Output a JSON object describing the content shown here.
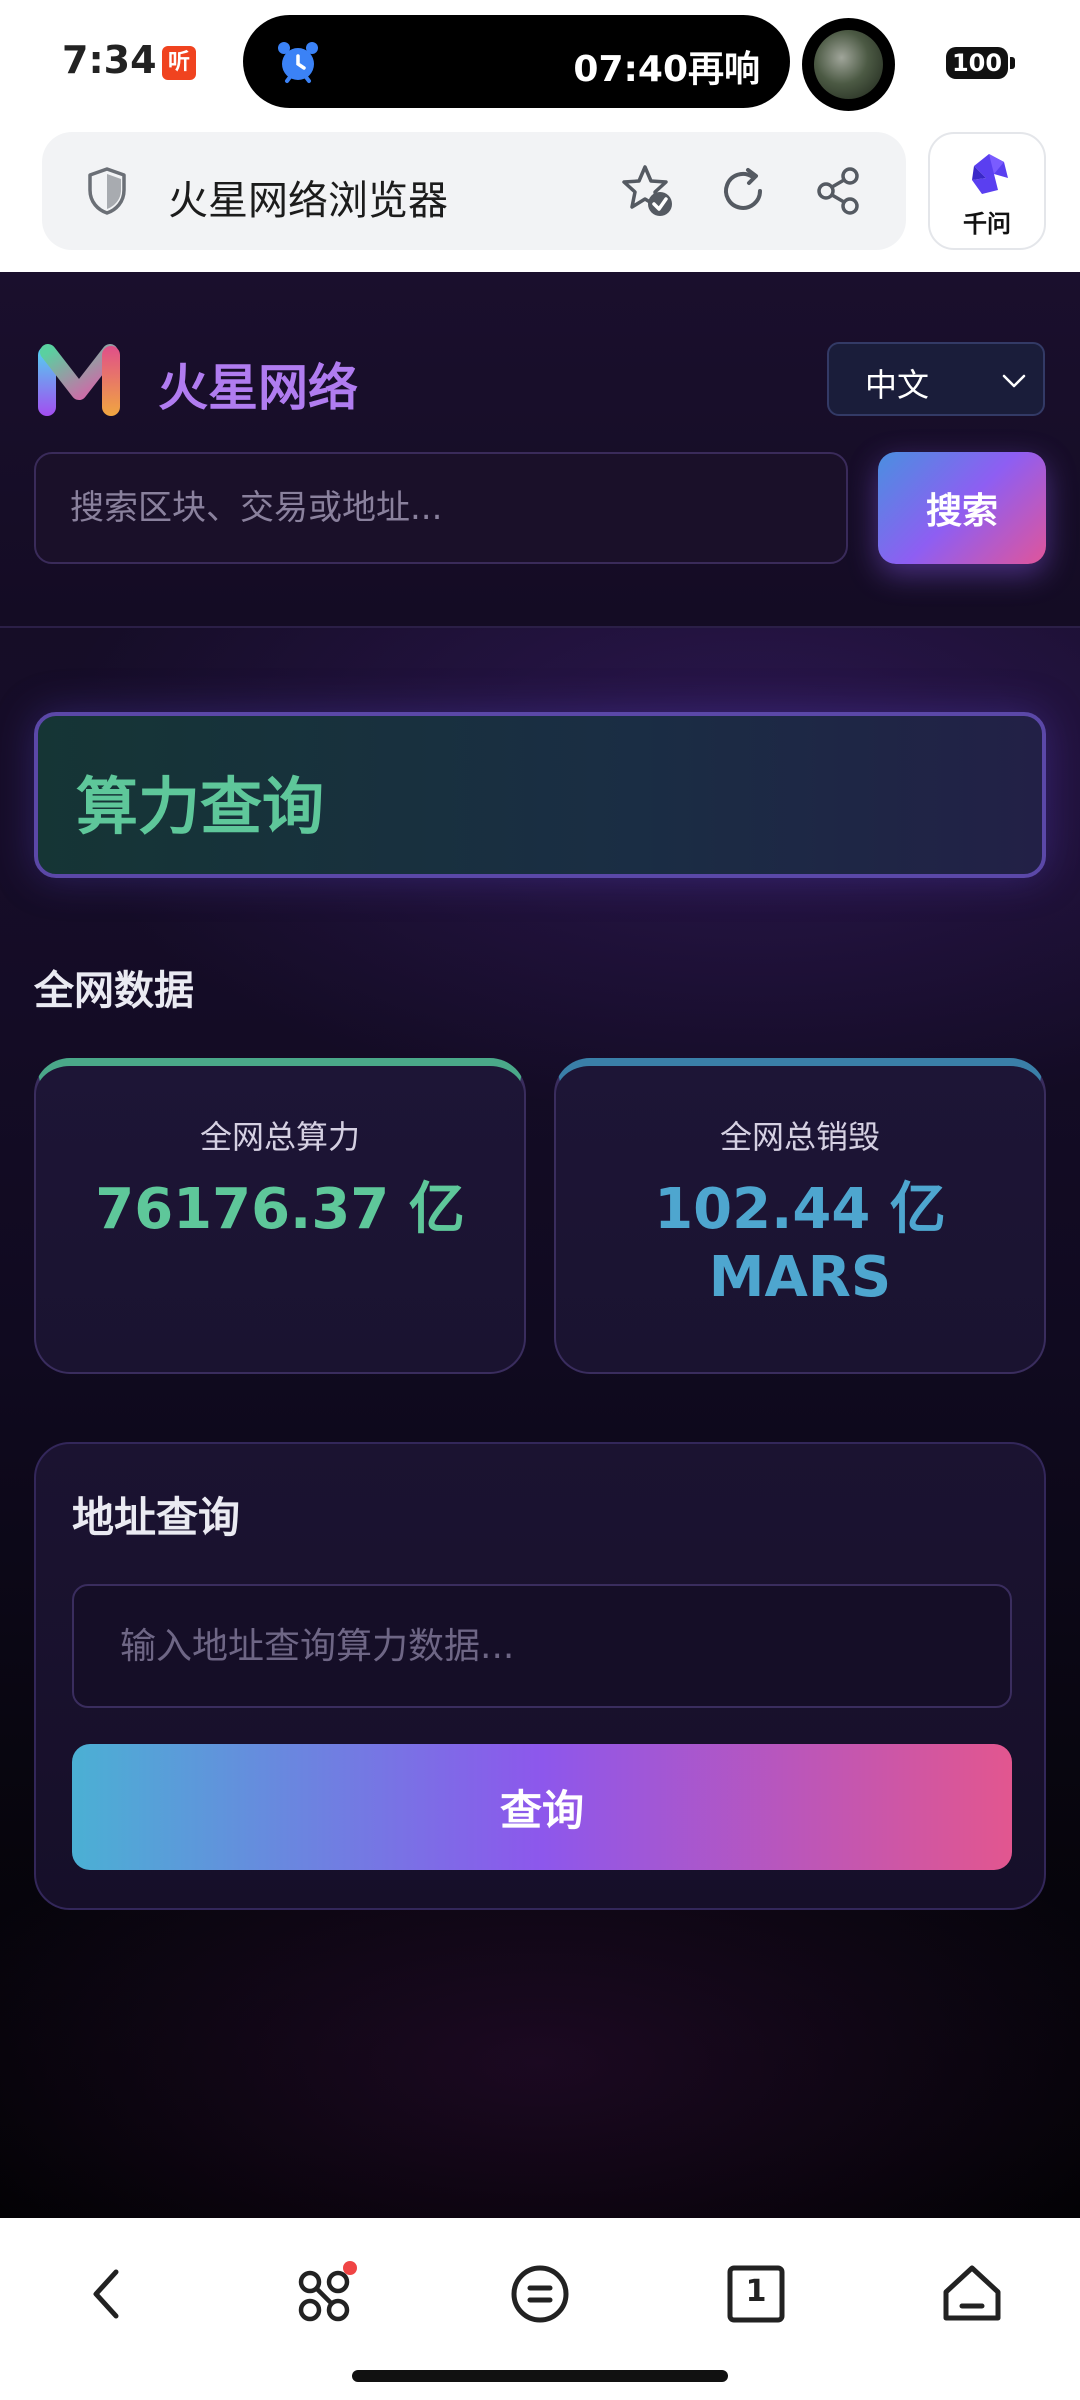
{
  "status_bar": {
    "time": "7:34",
    "listen_badge": "听",
    "island_text": "07:40再响",
    "battery": "100"
  },
  "browser": {
    "title": "火星网络浏览器",
    "assistant_label": "千问"
  },
  "site": {
    "name": "火星网络",
    "language": "中文",
    "search_placeholder": "搜索区块、交易或地址...",
    "search_button": "搜索"
  },
  "hero": {
    "title": "算力查询"
  },
  "network": {
    "section_title": "全网数据",
    "stats": [
      {
        "label": "全网总算力",
        "value": "76176.37 亿"
      },
      {
        "label": "全网总销毁",
        "value": "102.44 亿 MARS"
      }
    ]
  },
  "address_query": {
    "title": "地址查询",
    "placeholder": "输入地址查询算力数据...",
    "button": "查询"
  },
  "colors": {
    "accent_green": "#5ec79a",
    "accent_blue": "#4ea6cf",
    "gradient_start": "#4bb0d4",
    "gradient_mid": "#8d57ec",
    "gradient_end": "#e2568f",
    "page_background": "#150d26"
  },
  "icons": {
    "status": [
      "alarm-icon"
    ],
    "browser": [
      "shield-icon",
      "star-check-icon",
      "reload-icon",
      "share-icon",
      "qianwen-icon"
    ],
    "nav": [
      "back-icon",
      "apps-icon",
      "menu-icon",
      "tabs-icon",
      "home-icon"
    ]
  },
  "bottom_nav": {
    "tab_count": "1"
  }
}
